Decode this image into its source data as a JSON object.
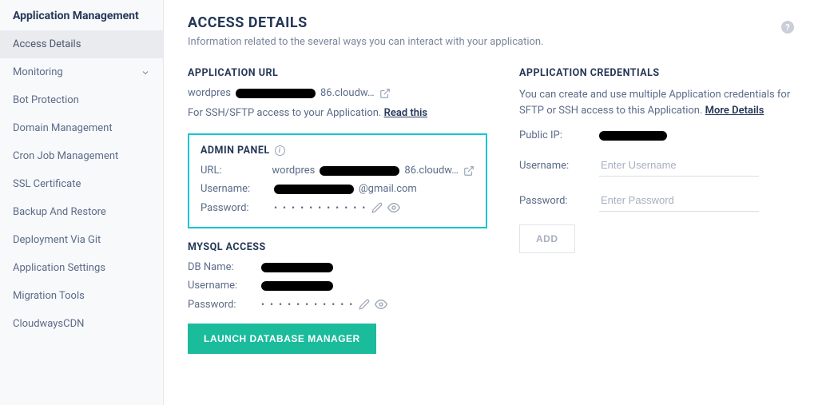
{
  "sidebar": {
    "header": "Application Management",
    "items": [
      {
        "label": "Access Details",
        "active": true,
        "expandable": false
      },
      {
        "label": "Monitoring",
        "active": false,
        "expandable": true
      },
      {
        "label": "Bot Protection",
        "active": false,
        "expandable": false
      },
      {
        "label": "Domain Management",
        "active": false,
        "expandable": false
      },
      {
        "label": "Cron Job Management",
        "active": false,
        "expandable": false
      },
      {
        "label": "SSL Certificate",
        "active": false,
        "expandable": false
      },
      {
        "label": "Backup And Restore",
        "active": false,
        "expandable": false
      },
      {
        "label": "Deployment Via Git",
        "active": false,
        "expandable": false
      },
      {
        "label": "Application Settings",
        "active": false,
        "expandable": false
      },
      {
        "label": "Migration Tools",
        "active": false,
        "expandable": false
      },
      {
        "label": "CloudwaysCDN",
        "active": false,
        "expandable": false
      }
    ]
  },
  "page": {
    "title": "ACCESS DETAILS",
    "subtitle": "Information related to the several ways you can interact with your application."
  },
  "app_url": {
    "section_title": "APPLICATION URL",
    "url_prefix": "wordpres",
    "url_suffix": "86.cloudw…",
    "hint_prefix": "For SSH/SFTP access to your Application. ",
    "hint_link": "Read this"
  },
  "admin_panel": {
    "section_title": "ADMIN PANEL",
    "url_label": "URL:",
    "url_prefix": "wordpres",
    "url_suffix": "86.cloudw…",
    "username_label": "Username:",
    "username_suffix": "@gmail.com",
    "password_label": "Password:",
    "password_masked": "• • • • • • • • • • •"
  },
  "mysql": {
    "section_title": "MYSQL ACCESS",
    "dbname_label": "DB Name:",
    "username_label": "Username:",
    "password_label": "Password:",
    "password_masked": "• • • • • • • • • • •",
    "launch_button": "LAUNCH DATABASE MANAGER"
  },
  "credentials": {
    "section_title": "APPLICATION CREDENTIALS",
    "description_prefix": "You can create and use multiple Application credentials for SFTP or SSH access to this Application. ",
    "more_link": "More Details",
    "public_ip_label": "Public IP:",
    "username_label": "Username:",
    "username_placeholder": "Enter Username",
    "password_label": "Password:",
    "password_placeholder": "Enter Password",
    "add_button": "ADD"
  }
}
